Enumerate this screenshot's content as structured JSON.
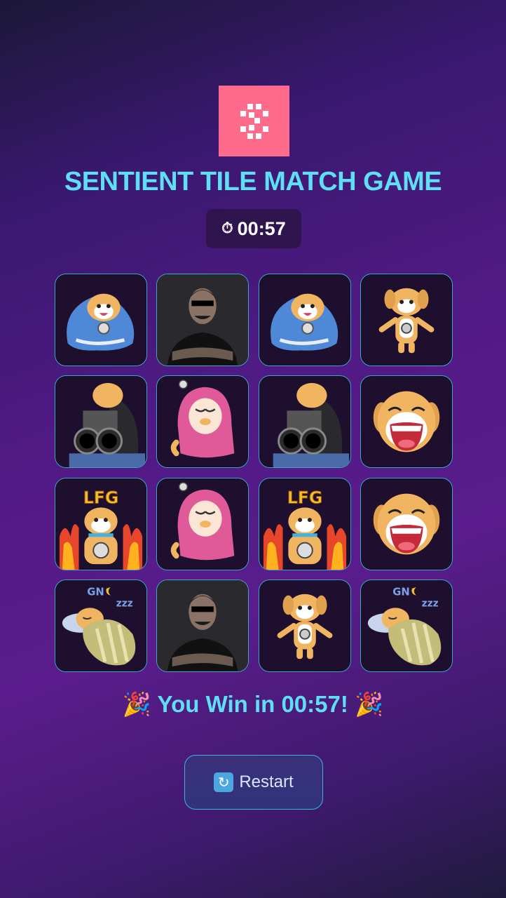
{
  "header": {
    "title": "SENTIENT TILE MATCH GAME",
    "logo_color": "#ff6b8a",
    "logo_icon": "sentient-logo-icon"
  },
  "timer": {
    "icon": "stopwatch-icon",
    "icon_glyph": "⏱",
    "value": "00:57"
  },
  "board": {
    "rows": 4,
    "columns": 4,
    "state": "all-revealed",
    "tiles": [
      {
        "sticker": "dog-blanket"
      },
      {
        "sticker": "man-sunglasses"
      },
      {
        "sticker": "dog-blanket"
      },
      {
        "sticker": "dog-shrug"
      },
      {
        "sticker": "dog-shotgun"
      },
      {
        "sticker": "dog-hijab"
      },
      {
        "sticker": "dog-shotgun"
      },
      {
        "sticker": "dog-laughing"
      },
      {
        "sticker": "dog-lfg-fire"
      },
      {
        "sticker": "dog-hijab"
      },
      {
        "sticker": "dog-lfg-fire"
      },
      {
        "sticker": "dog-laughing"
      },
      {
        "sticker": "dog-sleeping-gn"
      },
      {
        "sticker": "man-sunglasses"
      },
      {
        "sticker": "dog-shrug"
      },
      {
        "sticker": "dog-sleeping-gn"
      }
    ]
  },
  "win_message": "🎉 You Win in 00:57! 🎉",
  "restart": {
    "icon": "restart-icon",
    "icon_glyph": "🔄",
    "label": "Restart"
  },
  "sticker_text": {
    "lfg": "LFG",
    "gn": "GN",
    "zzz": "zzz"
  },
  "colors": {
    "accent_cyan": "#5fdff5",
    "tile_border": "#3aa7c8",
    "dog_fur": "#f1b561",
    "blanket_blue": "#4f88d6",
    "hijab_pink": "#e05a9a"
  }
}
